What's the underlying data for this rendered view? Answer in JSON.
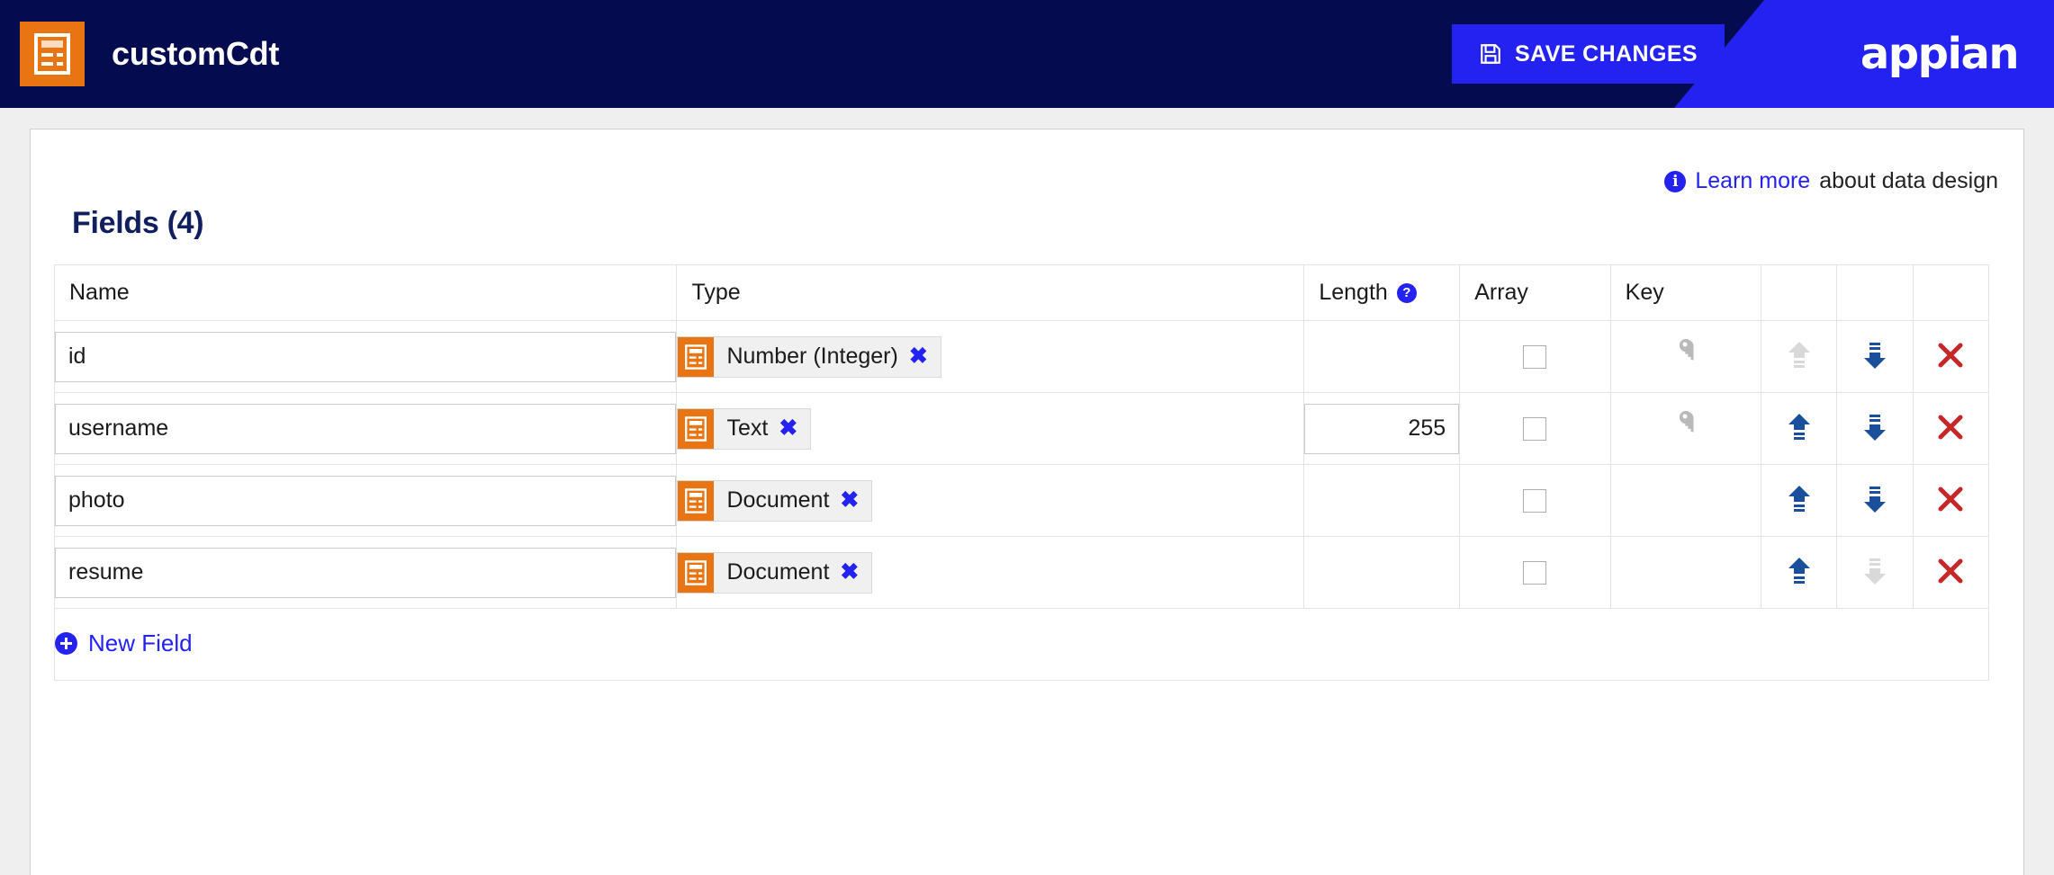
{
  "header": {
    "app_title": "customCdt",
    "app_icon": "cdt-document-icon",
    "save_label": "SAVE CHANGES",
    "save_icon": "floppy-save-icon",
    "settings_icon": "gear-icon",
    "settings_caret_icon": "chevron-down-icon",
    "search_icon": "globe-search-icon",
    "apps_icon": "grid-apps-icon",
    "avatar_icon": "user-avatar",
    "brand": "appian",
    "colors": {
      "navy": "#040b4e",
      "accent_blue": "#2322f0",
      "orange": "#e87511"
    }
  },
  "content": {
    "learn_more": {
      "info_icon": "info-icon",
      "link_label": "Learn more",
      "suffix_label": " about data design"
    },
    "section_title": "Fields",
    "section_count": "(4)",
    "table": {
      "columns": [
        {
          "label": "Name",
          "help": false
        },
        {
          "label": "Type",
          "help": false
        },
        {
          "label": "Length",
          "help": true
        },
        {
          "label": "Array",
          "help": false
        },
        {
          "label": "Key",
          "help": false
        },
        {
          "label": "",
          "help": false
        },
        {
          "label": "",
          "help": false
        },
        {
          "label": "",
          "help": false
        }
      ],
      "rows": [
        {
          "name": "id",
          "type": "Number (Integer)",
          "type_icon": "cdt-document-icon",
          "remove_type_icon": "x-icon",
          "length": "",
          "array_checked": false,
          "key": true,
          "move_up_enabled": false,
          "move_down_enabled": true,
          "delete_icon": "delete-x-icon"
        },
        {
          "name": "username",
          "type": "Text",
          "type_icon": "cdt-document-icon",
          "remove_type_icon": "x-icon",
          "length": "255",
          "array_checked": false,
          "key": true,
          "move_up_enabled": true,
          "move_down_enabled": true,
          "delete_icon": "delete-x-icon"
        },
        {
          "name": "photo",
          "type": "Document",
          "type_icon": "cdt-document-icon",
          "remove_type_icon": "x-icon",
          "length": "",
          "array_checked": false,
          "key": false,
          "move_up_enabled": true,
          "move_down_enabled": true,
          "delete_icon": "delete-x-icon"
        },
        {
          "name": "resume",
          "type": "Document",
          "type_icon": "cdt-document-icon",
          "remove_type_icon": "x-icon",
          "length": "",
          "array_checked": false,
          "key": false,
          "move_up_enabled": true,
          "move_down_enabled": false,
          "delete_icon": "delete-x-icon"
        }
      ],
      "new_field_label": "New Field",
      "new_field_icon": "plus-circle-icon"
    }
  }
}
